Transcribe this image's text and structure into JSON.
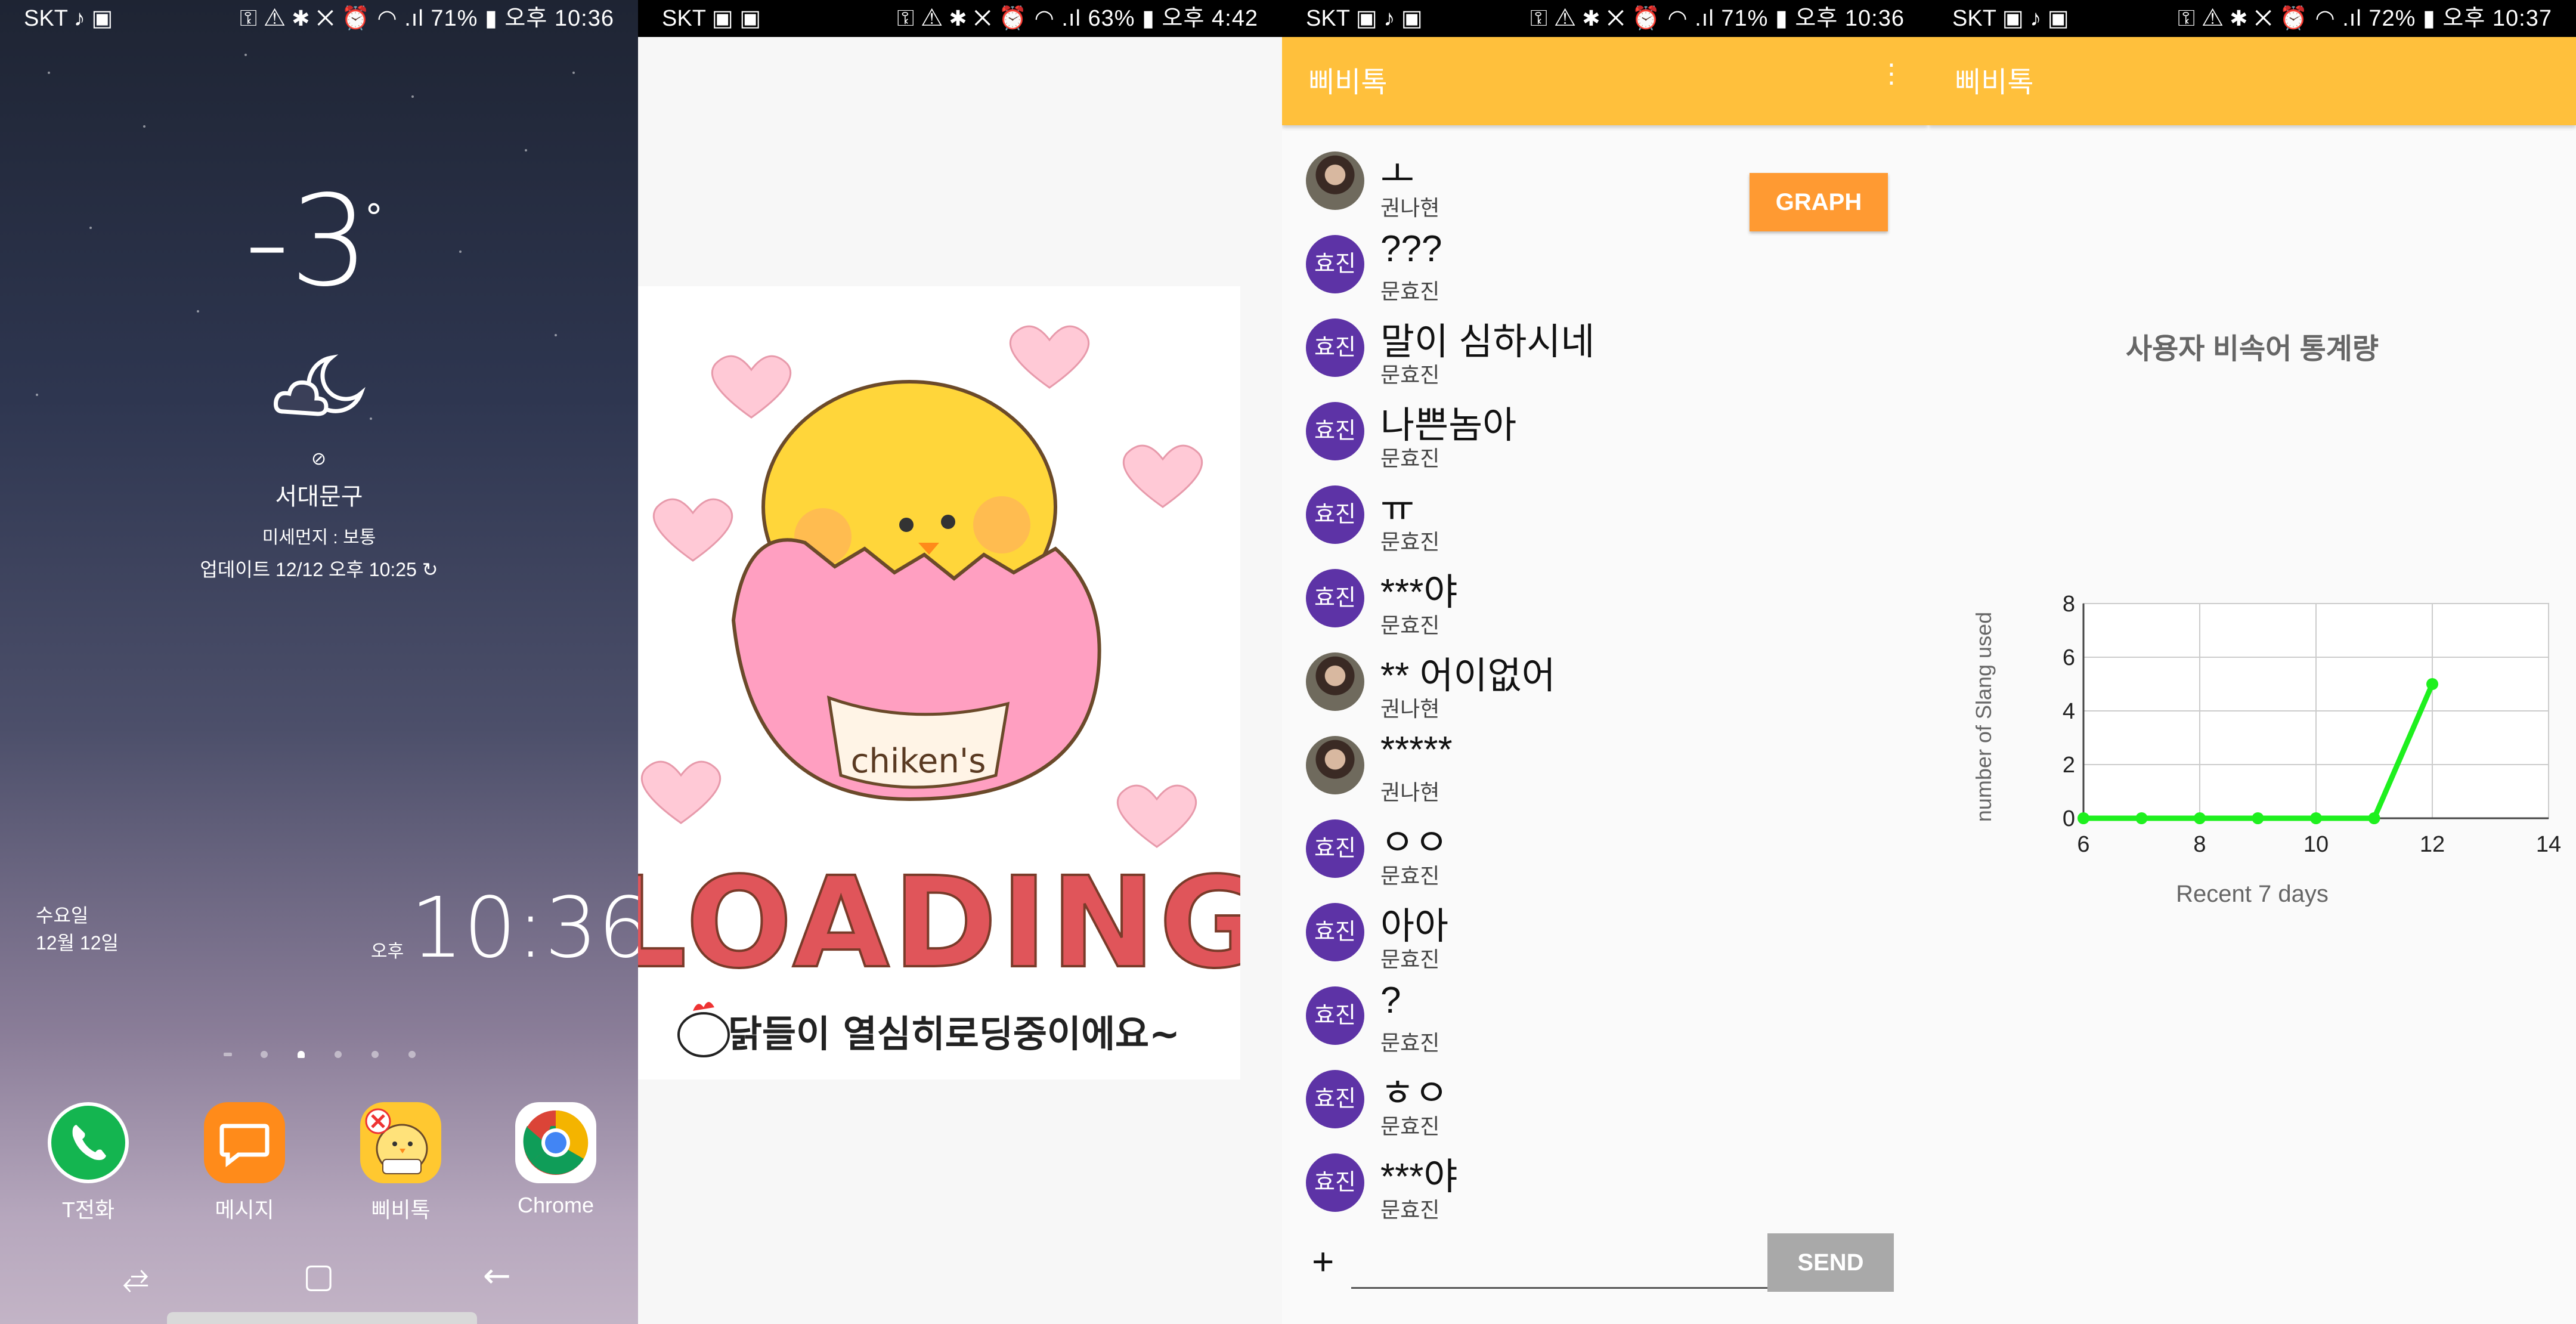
{
  "panels": [
    {
      "status": {
        "carrier": "SKT ♪ ▣",
        "right": "⚿ ⚠ ✱ ✕ ⏰ ◠ .ıl 71% ▮ 오후 10:36"
      },
      "weather": {
        "temp": "-3",
        "degree": "°",
        "city": "서대문구",
        "dust": "미세먼지 : 보통",
        "updated": "업데이트 12/12 오후 10:25 ↻"
      },
      "clock": {
        "day": "수요일",
        "date": "12월 12일",
        "ampm": "오후",
        "time": "10:36"
      },
      "dock": [
        {
          "label": "T전화",
          "icon": "phone-icon",
          "color": "#14b550"
        },
        {
          "label": "메시지",
          "icon": "message-icon",
          "color": "#ff8b1a"
        },
        {
          "label": "삐비톡",
          "icon": "chick-app-icon",
          "color": "#ffc830"
        },
        {
          "label": "Chrome",
          "icon": "chrome-icon",
          "color": "#ffffff"
        }
      ],
      "nav": {
        "recent": "⥄",
        "home": "▢",
        "back": "←"
      }
    },
    {
      "status": {
        "carrier": "SKT ▣ ▣",
        "right": "⚿ ⚠ ✱ ✕ ⏰ ◠ .ıl 63% ▮ 오후 4:42"
      },
      "loading": {
        "brand": "chiken's",
        "word": "LOADING",
        "subtitle": "닭들이 열심히로딩중이에요~"
      }
    },
    {
      "status": {
        "carrier": "SKT ▣ ♪ ▣",
        "right": "⚿ ⚠ ✱ ✕ ⏰ ◠ .ıl 71% ▮ 오후 10:36"
      },
      "app_title": "삐비톡",
      "overflow": "⋮",
      "graph_button": "GRAPH",
      "messages": [
        {
          "text": "ㅗ",
          "sender": "권나현",
          "avatar": "photo"
        },
        {
          "text": "???",
          "sender": "문효진",
          "avatar": "효진"
        },
        {
          "text": "말이 심하시네",
          "sender": "문효진",
          "avatar": "효진"
        },
        {
          "text": "나쁜놈아",
          "sender": "문효진",
          "avatar": "효진"
        },
        {
          "text": "ㅠ",
          "sender": "문효진",
          "avatar": "효진"
        },
        {
          "text": "***야",
          "sender": "문효진",
          "avatar": "효진"
        },
        {
          "text": "** 어이없어",
          "sender": "권나현",
          "avatar": "photo"
        },
        {
          "text": "*****",
          "sender": "권나현",
          "avatar": "photo"
        },
        {
          "text": "ㅇㅇ",
          "sender": "문효진",
          "avatar": "효진"
        },
        {
          "text": "아아",
          "sender": "문효진",
          "avatar": "효진"
        },
        {
          "text": "?",
          "sender": "문효진",
          "avatar": "효진"
        },
        {
          "text": "ㅎㅇ",
          "sender": "문효진",
          "avatar": "효진"
        },
        {
          "text": "***야",
          "sender": "문효진",
          "avatar": "효진"
        }
      ],
      "input": {
        "plus": "+",
        "value": "",
        "send": "SEND"
      }
    },
    {
      "status": {
        "carrier": "SKT ▣ ♪ ▣",
        "right": "⚿ ⚠ ✱ ✕ ⏰ ◠ .ıl 72% ▮ 오후 10:37"
      },
      "app_title": "삐비톡",
      "stats_title": "사용자 비속어 통계량"
    }
  ],
  "chart_data": {
    "type": "line",
    "x": [
      6,
      7,
      8,
      9,
      10,
      11,
      12
    ],
    "series": [
      {
        "values": [
          0,
          0,
          0,
          0,
          0,
          0,
          5
        ],
        "color": "#1ef01e"
      }
    ],
    "xlabel": "Recent 7 days",
    "ylabel": "number of Slang used",
    "xlim": [
      6,
      14
    ],
    "ylim": [
      0,
      8
    ],
    "xticks": [
      "6",
      "8",
      "10",
      "12",
      "14"
    ],
    "yticks": [
      "0",
      "2",
      "4",
      "6",
      "8"
    ],
    "grid": true
  }
}
